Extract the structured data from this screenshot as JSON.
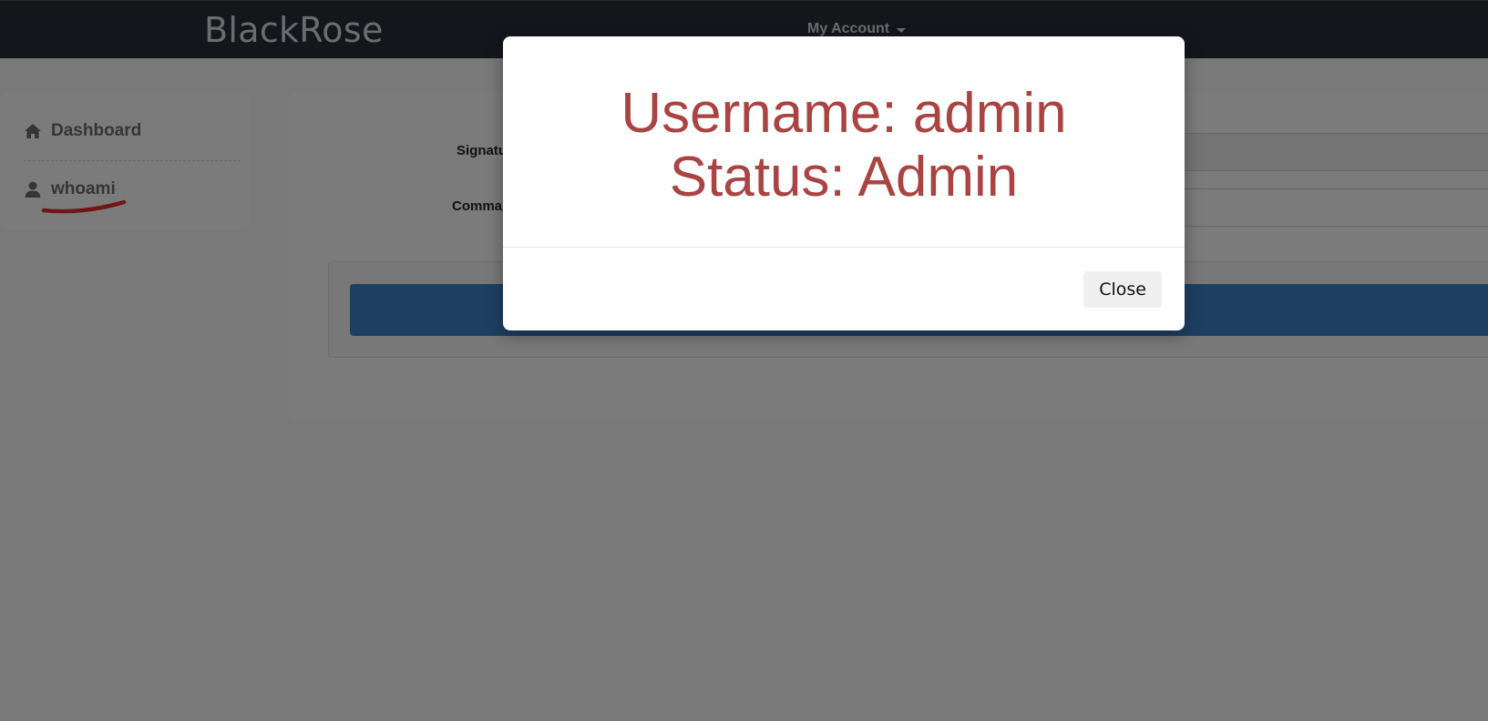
{
  "navbar": {
    "brand": "BlackRose",
    "account_menu": "My Account",
    "bg_color": "#272e38"
  },
  "sidebar": {
    "items": [
      {
        "label": "Dashboard",
        "icon": "home-icon"
      },
      {
        "label": "whoami",
        "icon": "user-icon"
      }
    ]
  },
  "main": {
    "fields": [
      {
        "label": "Signatu"
      },
      {
        "label": "Comma"
      }
    ],
    "primary_button_color": "#3d7ec4"
  },
  "modal": {
    "username_line": "Username: admin",
    "status_line": "Status: Admin",
    "text_color": "#a94442",
    "close_label": "Close"
  }
}
